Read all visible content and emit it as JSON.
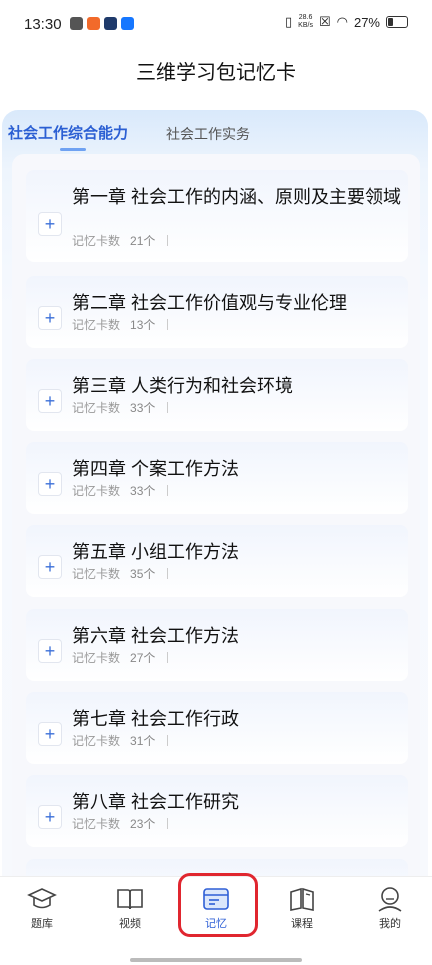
{
  "status": {
    "time": "13:30",
    "net_speed": "28.6",
    "net_unit": "KB/s",
    "battery": "27%"
  },
  "header": {
    "title": "三维学习包记忆卡"
  },
  "tabs": [
    {
      "label": "社会工作综合能力",
      "active": true
    },
    {
      "label": "社会工作实务",
      "active": false
    }
  ],
  "card_meta_label": "记忆卡数",
  "chapters": [
    {
      "title": "第一章 社会工作的内涵、原则及主要领域",
      "count": "21个"
    },
    {
      "title": "第二章 社会工作价值观与专业伦理",
      "count": "13个"
    },
    {
      "title": "第三章 人类行为和社会环境",
      "count": "33个"
    },
    {
      "title": "第四章 个案工作方法",
      "count": "33个"
    },
    {
      "title": "第五章 小组工作方法",
      "count": "35个"
    },
    {
      "title": "第六章 社会工作方法",
      "count": "27个"
    },
    {
      "title": "第七章 社会工作行政",
      "count": "31个"
    },
    {
      "title": "第八章 社会工作研究",
      "count": "23个"
    }
  ],
  "bottom_nav": [
    {
      "label": "题库",
      "icon": "graduation-cap-icon"
    },
    {
      "label": "视频",
      "icon": "book-open-icon"
    },
    {
      "label": "记忆",
      "icon": "card-icon",
      "active": true
    },
    {
      "label": "课程",
      "icon": "book-icon"
    },
    {
      "label": "我的",
      "icon": "user-icon"
    }
  ],
  "colors": {
    "accent": "#2e5fd6",
    "highlight": "#e0262f"
  }
}
